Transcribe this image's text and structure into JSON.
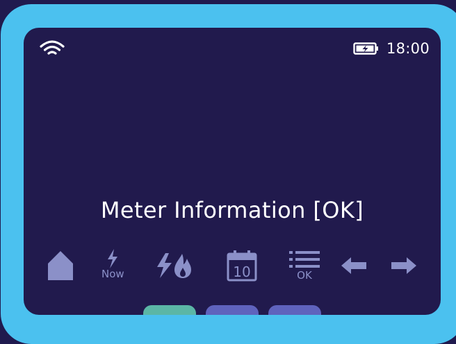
{
  "status_bar": {
    "wifi_icon": "wifi-icon",
    "battery_icon": "battery-charging-icon",
    "time": "18:00"
  },
  "page": {
    "title": "Meter Information [OK]"
  },
  "nav_icons": [
    {
      "name": "home-icon",
      "caption": ""
    },
    {
      "name": "electricity-now-icon",
      "caption": "Now"
    },
    {
      "name": "electricity-gas-icon",
      "caption": ""
    },
    {
      "name": "calendar-icon",
      "caption": "10"
    },
    {
      "name": "menu-list-icon",
      "caption": "OK"
    },
    {
      "name": "arrow-left-icon",
      "caption": ""
    },
    {
      "name": "arrow-right-icon",
      "caption": ""
    }
  ],
  "tabs": [
    {
      "name": "tab-1",
      "color": "#5bb6a6"
    },
    {
      "name": "tab-2",
      "color": "#5f63bd"
    },
    {
      "name": "tab-3",
      "color": "#5f63bd"
    }
  ],
  "colors": {
    "background": "#201a4e",
    "bezel": "#4bc1ef",
    "screen": "#211a4d",
    "icon": "#8b90c8",
    "text": "#ffffff"
  }
}
